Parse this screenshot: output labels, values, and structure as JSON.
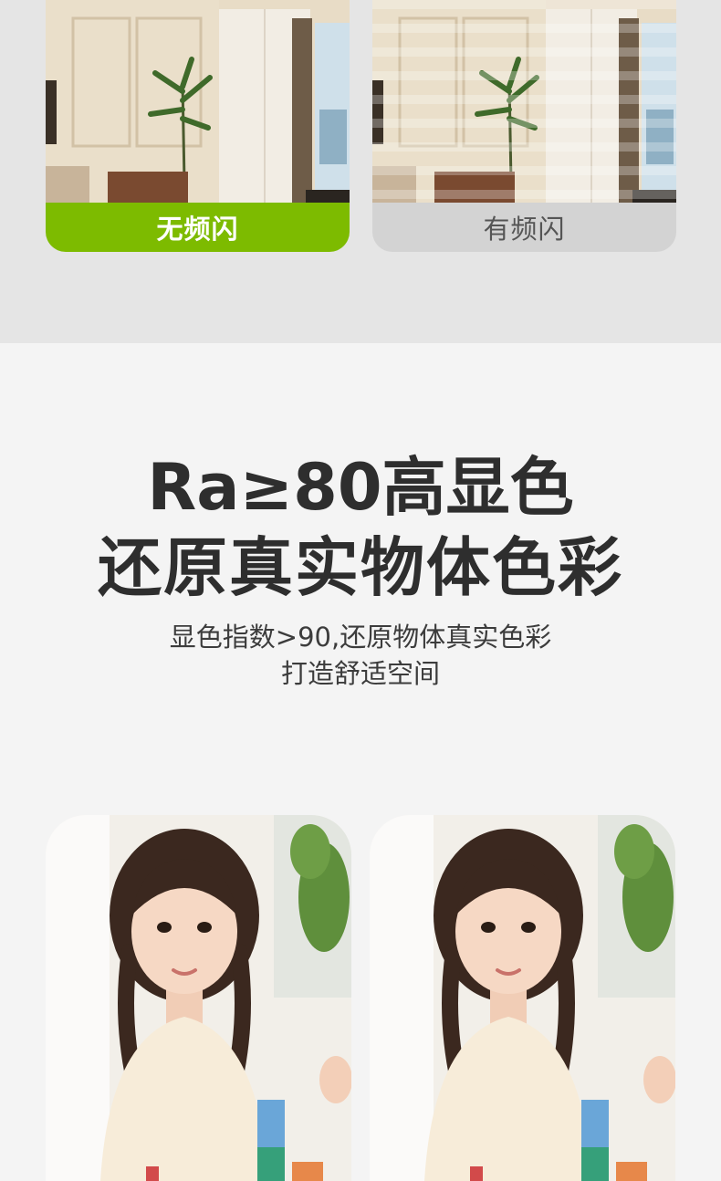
{
  "comparison": {
    "no_flicker_label": "无频闪",
    "flicker_label": "有频闪",
    "accent_color": "#7dbb00"
  },
  "headline": {
    "line1": "Ra≥80高显色",
    "line2": "还原真实物体色彩",
    "sub_line1": "显色指数>90,还原物体真实色彩",
    "sub_line2": "打造舒适空间"
  }
}
